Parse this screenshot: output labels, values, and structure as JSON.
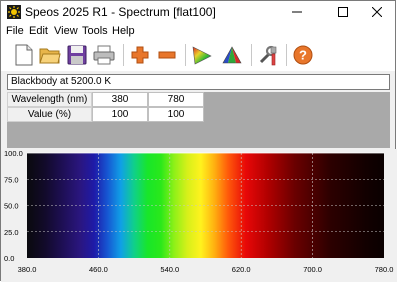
{
  "window": {
    "title": "Speos 2025 R1 - Spectrum [flat100]",
    "icon": "speos-app-icon",
    "controls": [
      "minimize",
      "maximize",
      "close"
    ]
  },
  "menu": [
    "File",
    "Edit",
    "View",
    "Tools",
    "Help"
  ],
  "toolbar": [
    "new-file-icon",
    "open-folder-icon",
    "save-icon",
    "print-icon",
    "add-icon",
    "remove-icon",
    "color-triangle-icon",
    "spectrum-triangle-icon",
    "tools-icon",
    "help-icon"
  ],
  "spectrum_name": "Blackbody at 5200.0 K",
  "table": {
    "rows": [
      {
        "label": "Wavelength (nm)",
        "v1": "380",
        "v2": "780"
      },
      {
        "label": "Value (%)",
        "v1": "100",
        "v2": "100"
      }
    ]
  },
  "chart_data": {
    "type": "area",
    "x": [
      380,
      780
    ],
    "series": [
      {
        "values": [
          100,
          100
        ]
      }
    ],
    "xlim": [
      380,
      780
    ],
    "ylim": [
      0,
      100
    ],
    "x_ticks": [
      "380.0",
      "460.0",
      "540.0",
      "620.0",
      "700.0",
      "780.0"
    ],
    "y_ticks": [
      "100.0",
      "75.0",
      "50.0",
      "25.0",
      "0.0"
    ],
    "grid": true,
    "fill": "visible-spectrum gradient"
  }
}
